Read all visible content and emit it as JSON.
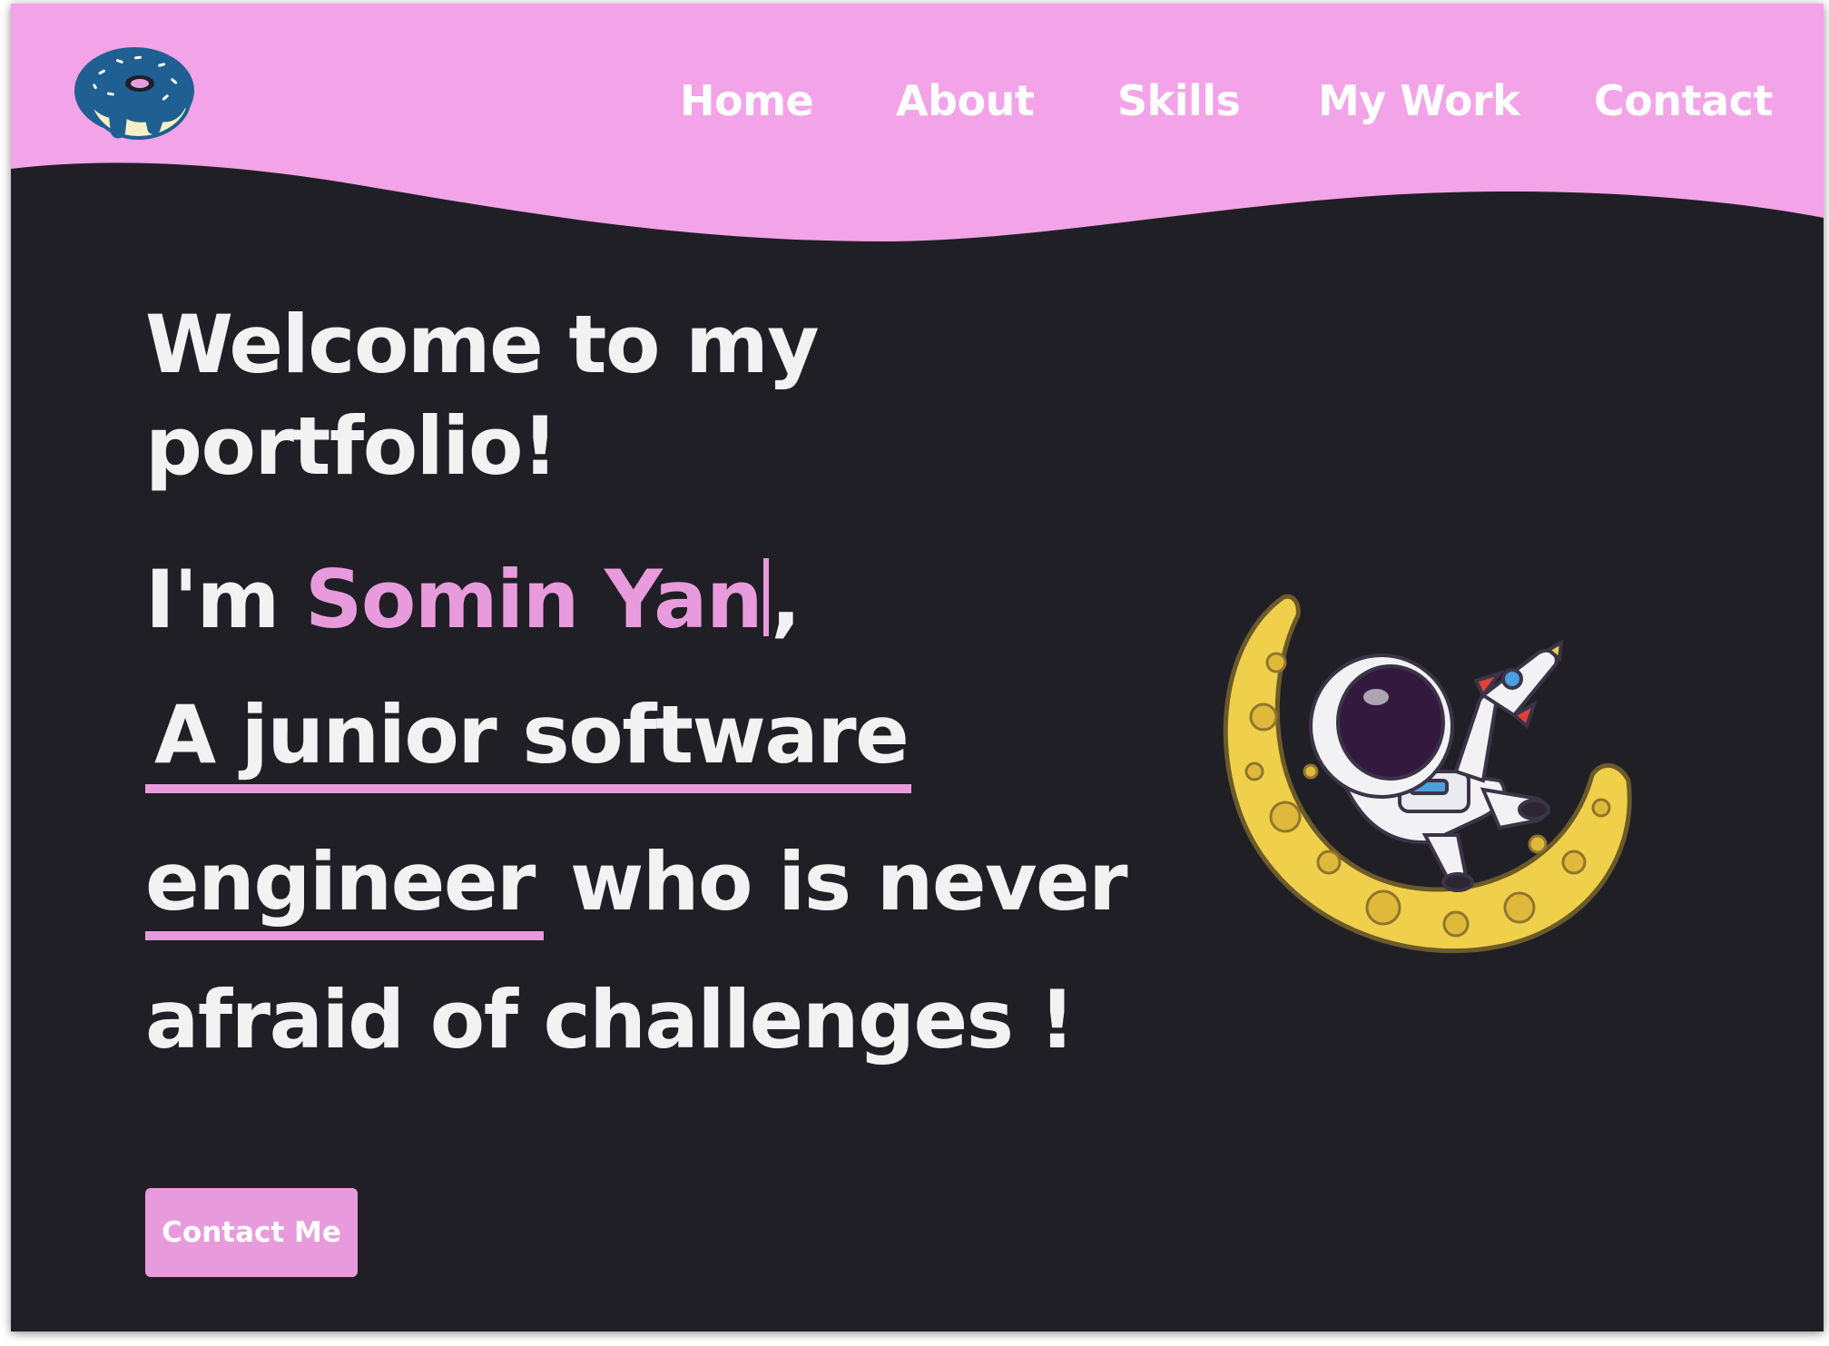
{
  "nav": {
    "items": [
      {
        "label": "Home"
      },
      {
        "label": "About"
      },
      {
        "label": "Skills"
      },
      {
        "label": "My Work"
      },
      {
        "label": "Contact"
      }
    ]
  },
  "hero": {
    "title": "Welcome to my portfolio!",
    "intro_prefix": "I'm ",
    "name": "Somin Yan",
    "intro_suffix": ",",
    "line1_highlight": "A junior software",
    "line2_highlight": "engineer",
    "line2_rest": " who is never",
    "line3": "afraid of challenges !"
  },
  "cta": {
    "label": "Contact Me"
  },
  "colors": {
    "header": "#f3a3e8",
    "background": "#201f25",
    "accent": "#e89bdc",
    "text": "#f2f2f2"
  },
  "icons": {
    "logo": "donut-logo-icon",
    "illustration": "astronaut-on-moon-illustration"
  }
}
